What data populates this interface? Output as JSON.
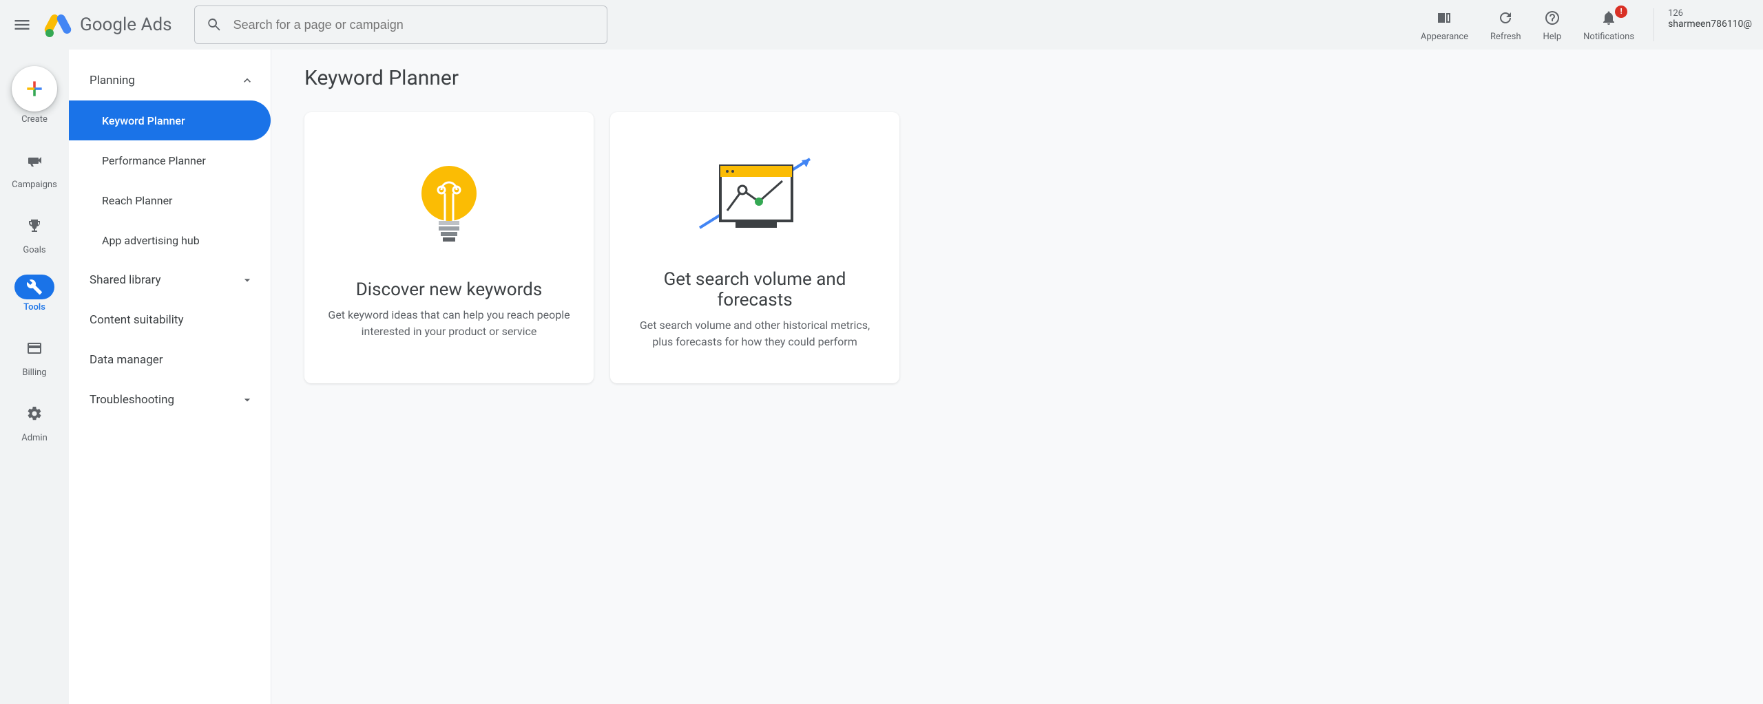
{
  "header": {
    "brand": "Google Ads",
    "search_placeholder": "Search for a page or campaign",
    "actions": {
      "appearance": "Appearance",
      "refresh": "Refresh",
      "help": "Help",
      "notifications": "Notifications",
      "notifications_badge": "!"
    },
    "account": {
      "id": "126",
      "email": "sharmeen786110@"
    }
  },
  "rail": {
    "create": "Create",
    "campaigns": "Campaigns",
    "goals": "Goals",
    "tools": "Tools",
    "billing": "Billing",
    "admin": "Admin"
  },
  "subnav": {
    "planning": {
      "label": "Planning",
      "items": {
        "keyword_planner": "Keyword Planner",
        "performance_planner": "Performance Planner",
        "reach_planner": "Reach Planner",
        "app_hub": "App advertising hub"
      }
    },
    "shared_library": "Shared library",
    "content_suitability": "Content suitability",
    "data_manager": "Data manager",
    "troubleshooting": "Troubleshooting"
  },
  "main": {
    "title": "Keyword Planner",
    "card1": {
      "title": "Discover new keywords",
      "desc": "Get keyword ideas that can help you reach people interested in your product or service"
    },
    "card2": {
      "title": "Get search volume and forecasts",
      "desc": "Get search volume and other historical metrics, plus forecasts for how they could perform"
    }
  }
}
